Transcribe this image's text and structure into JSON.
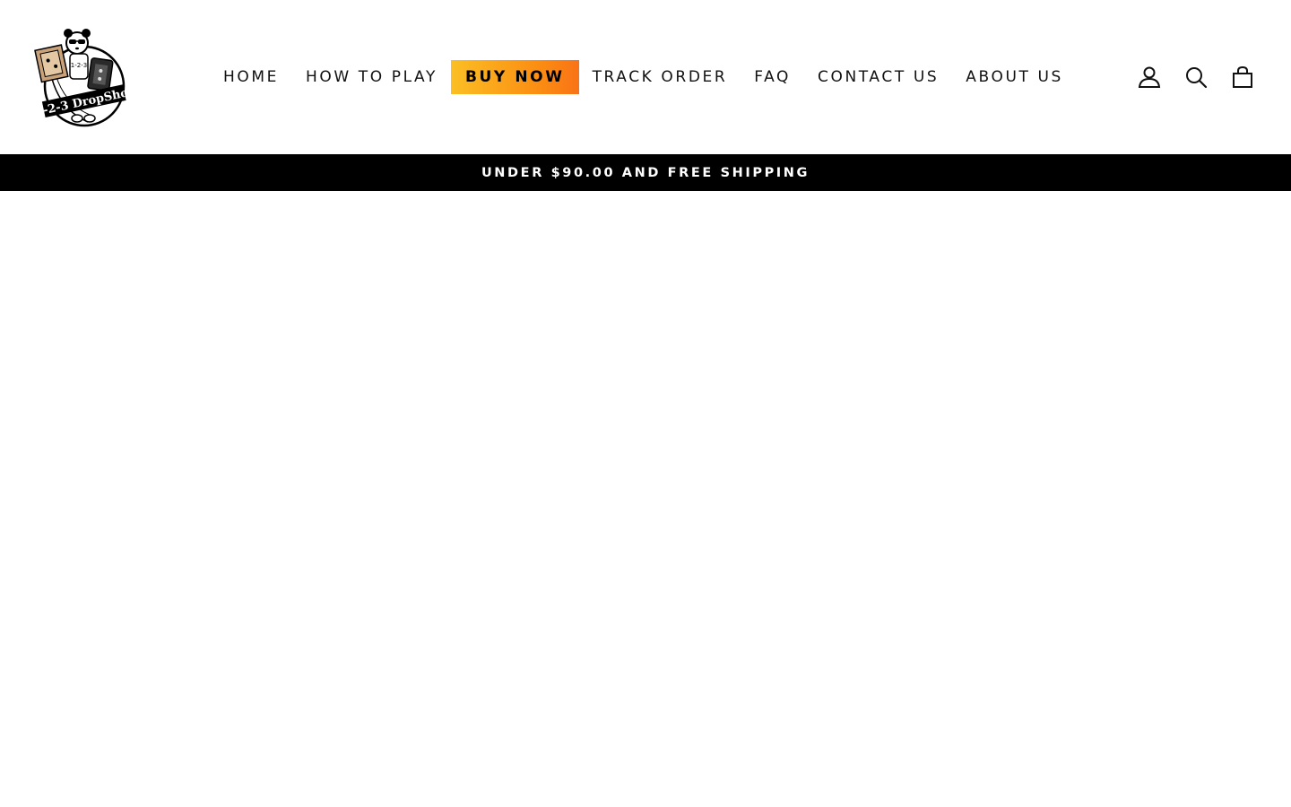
{
  "brand": {
    "logo_text": "1-2-3 DropShot",
    "logo_badge_text": "1-2-3"
  },
  "nav": {
    "items": [
      {
        "label": "HOME"
      },
      {
        "label": "HOW TO PLAY"
      },
      {
        "label": "BUY NOW"
      },
      {
        "label": "TRACK ORDER"
      },
      {
        "label": "FAQ"
      },
      {
        "label": "CONTACT US"
      },
      {
        "label": "ABOUT US"
      }
    ]
  },
  "icons": [
    "user-icon",
    "search-icon",
    "bag-icon"
  ],
  "announcement": {
    "text": "UNDER $90.00 AND FREE SHIPPING"
  },
  "colors": {
    "accent_gradient_start": "#fbbf24",
    "accent_gradient_end": "#f97316",
    "announcement_bg": "#000000",
    "text": "#111111"
  }
}
